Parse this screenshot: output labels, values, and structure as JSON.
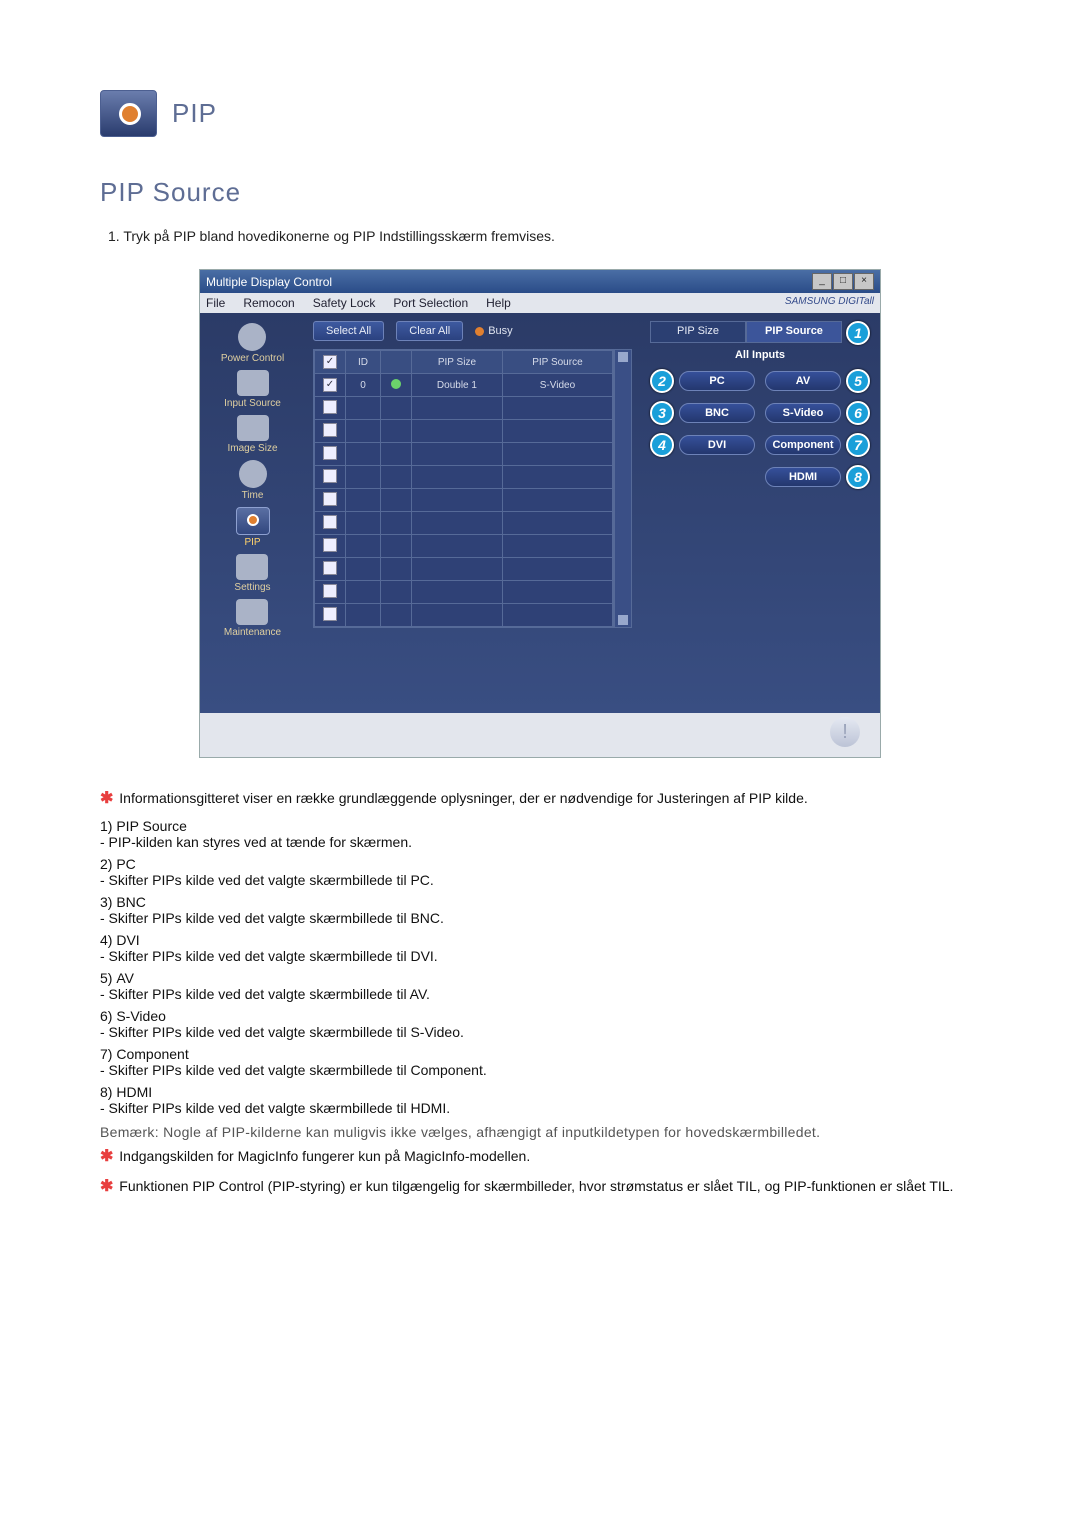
{
  "header": {
    "title": "PIP"
  },
  "section": {
    "title": "PIP Source",
    "intro": "1.  Tryk på PIP bland hovedikonerne og PIP Indstillingsskærm fremvises."
  },
  "screenshot": {
    "titlebar": "Multiple Display Control",
    "menubar": [
      "File",
      "Remocon",
      "Safety Lock",
      "Port Selection",
      "Help"
    ],
    "brand": "SAMSUNG DIGITall",
    "sidebar": [
      {
        "label": "Power Control"
      },
      {
        "label": "Input Source"
      },
      {
        "label": "Image Size"
      },
      {
        "label": "Time"
      },
      {
        "label": "PIP"
      },
      {
        "label": "Settings"
      },
      {
        "label": "Maintenance"
      }
    ],
    "toolbar": {
      "select_all": "Select All",
      "clear_all": "Clear All",
      "busy": "Busy"
    },
    "grid": {
      "headers": [
        "",
        "ID",
        "",
        "PIP Size",
        "PIP Source"
      ],
      "row": {
        "id": "0",
        "pip_size": "Double 1",
        "pip_source": "S-Video"
      }
    },
    "rightpanel": {
      "tabs": {
        "left": "PIP Size",
        "right": "PIP Source"
      },
      "subheader": "All Inputs",
      "buttons": {
        "pc": "PC",
        "av": "AV",
        "bnc": "BNC",
        "svideo": "S-Video",
        "dvi": "DVI",
        "component": "Component",
        "hdmi": "HDMI"
      },
      "callouts": {
        "pipsrc": "1",
        "pc": "2",
        "bnc": "3",
        "dvi": "4",
        "av": "5",
        "svideo": "6",
        "component": "7",
        "hdmi": "8"
      }
    }
  },
  "notes": {
    "intro_note": "Informationsgitteret viser en række grundlæggende oplysninger, der er nødvendige for Justeringen af PIP kilde.",
    "items": [
      {
        "num": "1)",
        "title": "PIP Source",
        "desc": "- PIP-kilden kan styres ved at tænde for skærmen."
      },
      {
        "num": "2)",
        "title": "PC",
        "desc": "- Skifter PIPs kilde ved det valgte skærmbillede til PC."
      },
      {
        "num": "3)",
        "title": "BNC",
        "desc": "- Skifter PIPs kilde ved det valgte skærmbillede til BNC."
      },
      {
        "num": "4)",
        "title": "DVI",
        "desc": "- Skifter PIPs kilde ved det valgte skærmbillede til DVI."
      },
      {
        "num": "5)",
        "title": "AV",
        "desc": "- Skifter PIPs kilde ved det valgte skærmbillede til AV."
      },
      {
        "num": "6)",
        "title": "S-Video",
        "desc": "- Skifter PIPs kilde ved det valgte skærmbillede til S-Video."
      },
      {
        "num": "7)",
        "title": "Component",
        "desc": "- Skifter PIPs kilde ved det valgte skærmbillede til Component."
      },
      {
        "num": "8)",
        "title": "HDMI",
        "desc": "- Skifter PIPs kilde ved det valgte skærmbillede til HDMI."
      }
    ],
    "remark": "Bemærk: Nogle af PIP-kilderne kan muligvis ikke vælges, afhængigt af inputkildetypen for hovedskærmbilledet.",
    "footer1": "Indgangskilden for MagicInfo fungerer kun på MagicInfo-modellen.",
    "footer2": "Funktionen PIP Control (PIP-styring) er kun tilgængelig for skærmbilleder, hvor strømstatus er slået TIL, og PIP-funktionen er slået TIL."
  }
}
